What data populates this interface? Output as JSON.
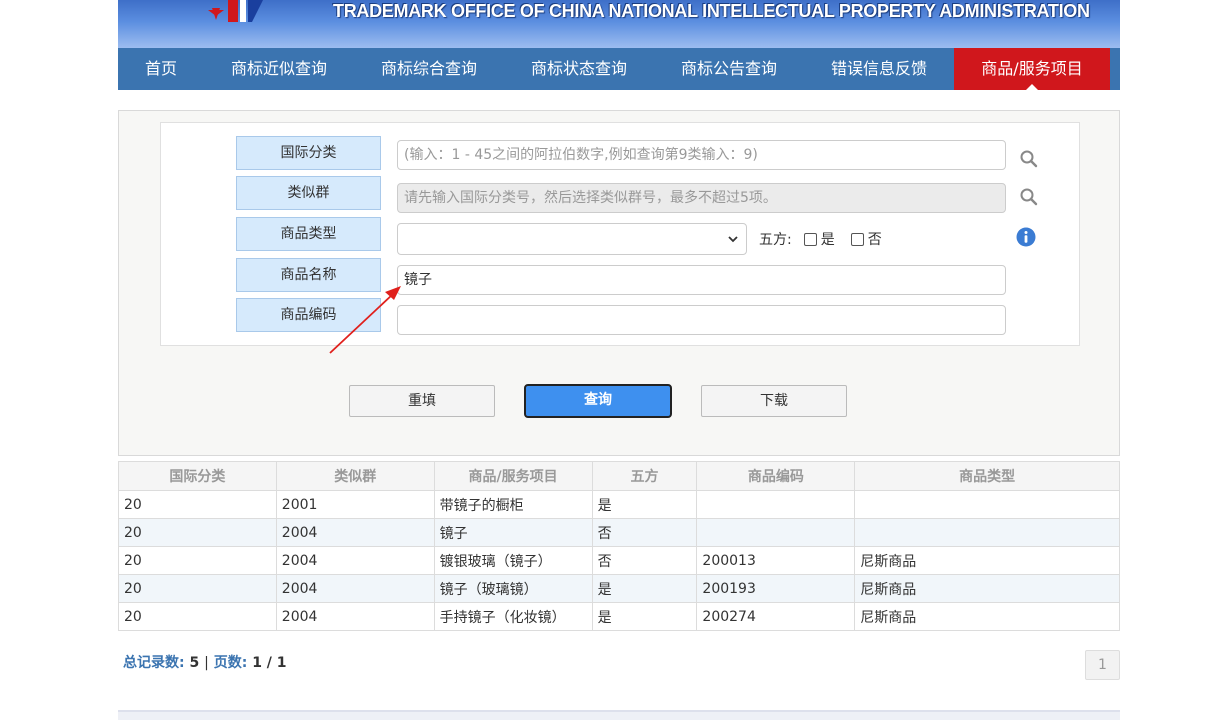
{
  "header": {
    "title": "TRADEMARK OFFICE OF CHINA NATIONAL INTELLECTUAL PROPERTY ADMINISTRATION"
  },
  "nav": {
    "items": [
      {
        "label": "首页"
      },
      {
        "label": "商标近似查询"
      },
      {
        "label": "商标综合查询"
      },
      {
        "label": "商标状态查询"
      },
      {
        "label": "商标公告查询"
      },
      {
        "label": "错误信息反馈"
      },
      {
        "label": "商品/服务项目"
      }
    ],
    "active_index": 6
  },
  "form": {
    "intl_class": {
      "label": "国际分类",
      "placeholder": "(输入：1 - 45之间的阿拉伯数字,例如查询第9类输入：9)"
    },
    "similar_group": {
      "label": "类似群",
      "placeholder": "请先输入国际分类号，然后选择类似群号，最多不超过5项。"
    },
    "goods_type": {
      "label": "商品类型",
      "selected": ""
    },
    "wufang": {
      "label": "五方:",
      "yes": "是",
      "no": "否"
    },
    "goods_name": {
      "label": "商品名称",
      "value": "镜子"
    },
    "goods_code": {
      "label": "商品编码",
      "value": ""
    },
    "buttons": {
      "reset": "重填",
      "search": "查询",
      "download": "下载"
    }
  },
  "table": {
    "headers": [
      "国际分类",
      "类似群",
      "商品/服务项目",
      "五方",
      "商品编码",
      "商品类型"
    ],
    "rows": [
      [
        "20",
        "2001",
        "带镜子的橱柜",
        "是",
        "",
        ""
      ],
      [
        "20",
        "2004",
        "镜子",
        "否",
        "",
        ""
      ],
      [
        "20",
        "2004",
        "镀银玻璃（镜子）",
        "否",
        "200013",
        "尼斯商品"
      ],
      [
        "20",
        "2004",
        "镜子（玻璃镜）",
        "是",
        "200193",
        "尼斯商品"
      ],
      [
        "20",
        "2004",
        "手持镜子（化妆镜）",
        "是",
        "200274",
        "尼斯商品"
      ]
    ]
  },
  "summary": {
    "total_label": "总记录数:",
    "total": "5",
    "sep": "|",
    "pages_label": "页数:",
    "pages": "1 / 1"
  },
  "pager": {
    "current": "1"
  },
  "colors": {
    "nav": "#3b74b0",
    "active": "#d0171c",
    "primary": "#3e90ef",
    "label_bg": "#d6eafc"
  }
}
